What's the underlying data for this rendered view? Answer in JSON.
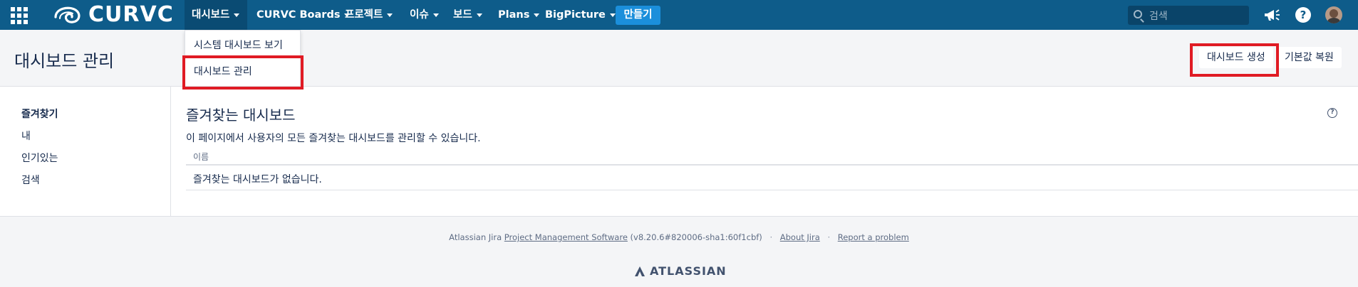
{
  "brand": {
    "logo_text": "CURVC"
  },
  "nav": {
    "items": [
      {
        "label": "대시보드",
        "has_caret": true
      },
      {
        "label": "CURVC Boards",
        "has_caret": true
      },
      {
        "label": "프로젝트",
        "has_caret": true
      },
      {
        "label": "이슈",
        "has_caret": true
      },
      {
        "label": "보드",
        "has_caret": true
      },
      {
        "label": "Plans",
        "has_caret": true
      },
      {
        "label": "BigPicture",
        "has_caret": true
      }
    ],
    "create_label": "만들기",
    "search_placeholder": "검색",
    "help_label": "?"
  },
  "dropdown": {
    "items": [
      {
        "label": "시스템 대시보드 보기"
      },
      {
        "label": "대시보드 관리"
      }
    ]
  },
  "header": {
    "title": "대시보드 관리",
    "create_dashboard_label": "대시보드 생성",
    "restore_default_label": "기본값 복원"
  },
  "sidebar": {
    "items": [
      {
        "label": "즐겨찾기",
        "selected": true
      },
      {
        "label": "내",
        "selected": false
      },
      {
        "label": "인기있는",
        "selected": false
      },
      {
        "label": "검색",
        "selected": false
      }
    ]
  },
  "main": {
    "section_title": "즐겨찾는 대시보드",
    "description": "이 페이지에서 사용자의 모든 즐겨찾는 대시보드를 관리할 수 있습니다.",
    "table": {
      "columns": [
        "이름"
      ],
      "empty_message": "즐겨찾는 대시보드가 없습니다."
    },
    "help_icon_label": "?"
  },
  "footer": {
    "prefix": "Atlassian Jira",
    "product_link": "Project Management Software",
    "version": "(v8.20.6#820006-sha1:60f1cbf)",
    "about_link": "About Jira",
    "report_link": "Report a problem",
    "separator": "·",
    "brand": "ATLASSIAN"
  },
  "colors": {
    "topbar": "#0e5c8a",
    "create_button": "#1b8fdb",
    "highlight": "#e01b24"
  }
}
